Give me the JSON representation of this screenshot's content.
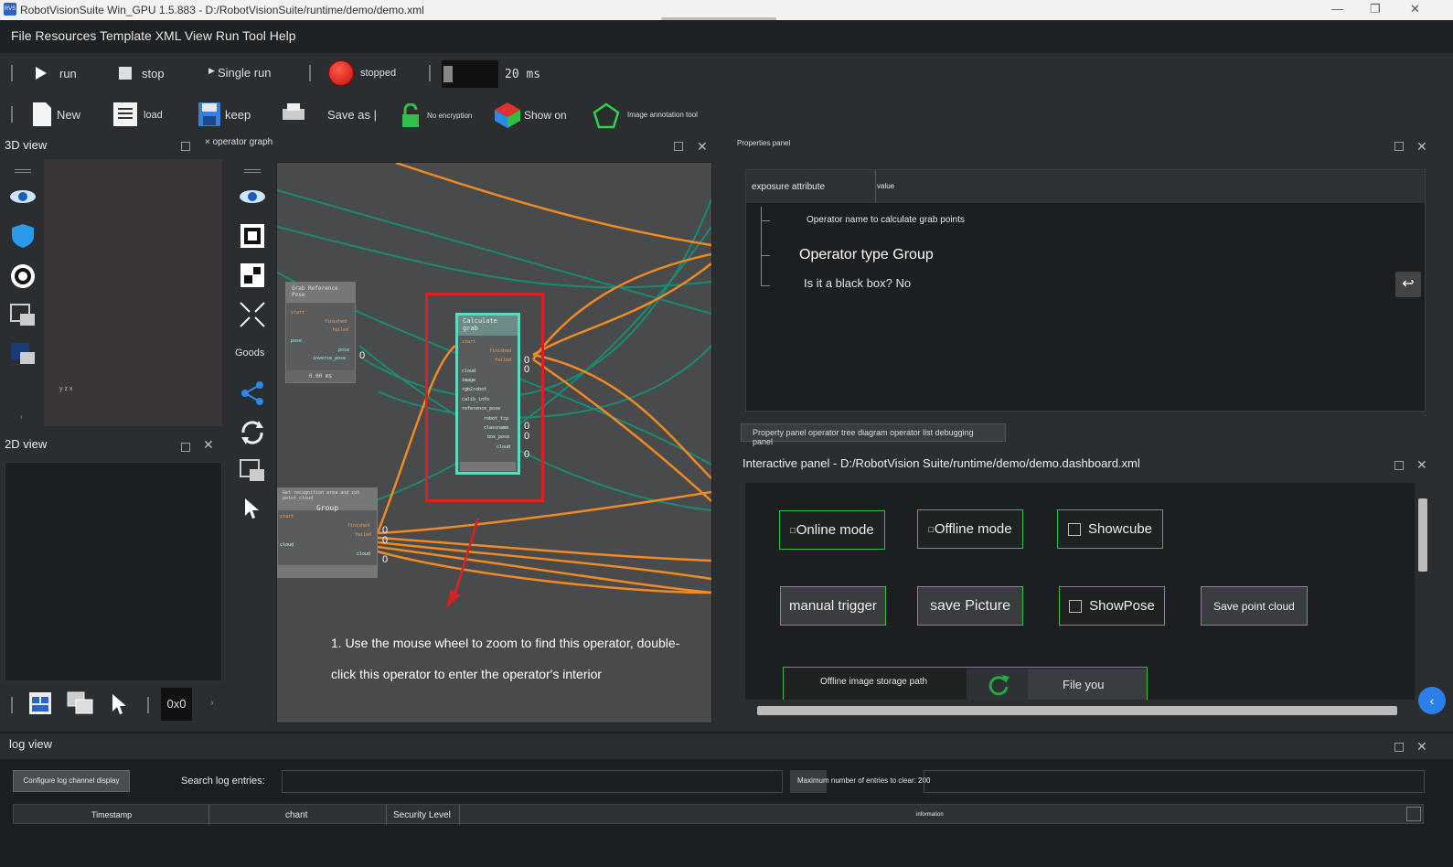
{
  "window": {
    "title": "RobotVisionSuite Win_GPU 1.5.883 - D:/RobotVisionSuite/runtime/demo/demo.xml",
    "app_icon": "RVS",
    "minimize": "—",
    "restore": "❐",
    "close": "✕"
  },
  "menu": {
    "text": "File Resources Template XML View Run Tool Help"
  },
  "runbar": {
    "run": "run",
    "stop": "stop",
    "single_run": "Single run",
    "status": "stopped",
    "interval": "20 ms"
  },
  "filebar": {
    "new": "New",
    "load": "load",
    "keep": "keep",
    "save_as": "Save as |",
    "no_encryption": "No encryption",
    "show_on": "Show on",
    "annotation": "Image annotation tool"
  },
  "view3d": {
    "title": "3D view",
    "axis": "y z x"
  },
  "view2d": {
    "title": "2D view",
    "size": "0x0"
  },
  "graph": {
    "tab": "× operator graph",
    "goods": "Goods",
    "node_grab_ref": {
      "title": "Grab Reference Pose",
      "ports": [
        "start",
        "finished",
        "failed",
        "pose",
        "pose",
        "inverse_pose"
      ],
      "time": "0.00 ms"
    },
    "node_calc": {
      "title": "Calculate grab",
      "ports_in": [
        "start",
        "cloud",
        "image",
        "rgb2robot",
        "calib_info",
        "reference_pose"
      ],
      "ports_out": [
        "finished",
        "failed",
        "robot_tcp",
        "classname",
        "box_pose",
        "cloud"
      ]
    },
    "node_group": {
      "subtitle": "Get recognition area and cut point cloud",
      "title": "Group",
      "ports": [
        "start",
        "finished",
        "failed",
        "cloud",
        "cloud"
      ]
    },
    "zero": "0",
    "instruction_line1": "1. Use the mouse wheel to zoom to find this operator, double-",
    "instruction_line2": "click this operator to enter the operator's interior"
  },
  "props": {
    "title": "Properties panel",
    "col_attr": "exposure attribute",
    "col_value": "value",
    "operator_name": "Operator name to calculate grab points",
    "operator_type": "Operator type Group",
    "blackbox": "Is it a black box? No",
    "tabs": "Property panel operator tree diagram operator list debugging panel"
  },
  "interactive": {
    "title": "Interactive panel - D:/RobotVision Suite/runtime/demo/demo.dashboard.xml",
    "online": "Online mode",
    "offline": "Offline mode",
    "showcube": "Showcube",
    "manual": "manual trigger",
    "save_pic": "save Picture",
    "showpose": "ShowPose",
    "save_cloud": "Save point cloud",
    "storage": "Offline image storage path",
    "file": "File you"
  },
  "log": {
    "title": "log view",
    "config": "Configure log channel display",
    "search_label": "Search log entries:",
    "search_value": "",
    "max_label": "Maximum number of entries to clear: 200",
    "cols": [
      "Timestamp",
      "chant",
      "Security Level",
      "information"
    ]
  },
  "colors": {
    "accent_green": "#2fbf4a",
    "wire_orange": "#f08a24",
    "wire_teal": "#1a8a72",
    "highlight_red": "#e02020",
    "node_teal": "#5fd6c0"
  }
}
